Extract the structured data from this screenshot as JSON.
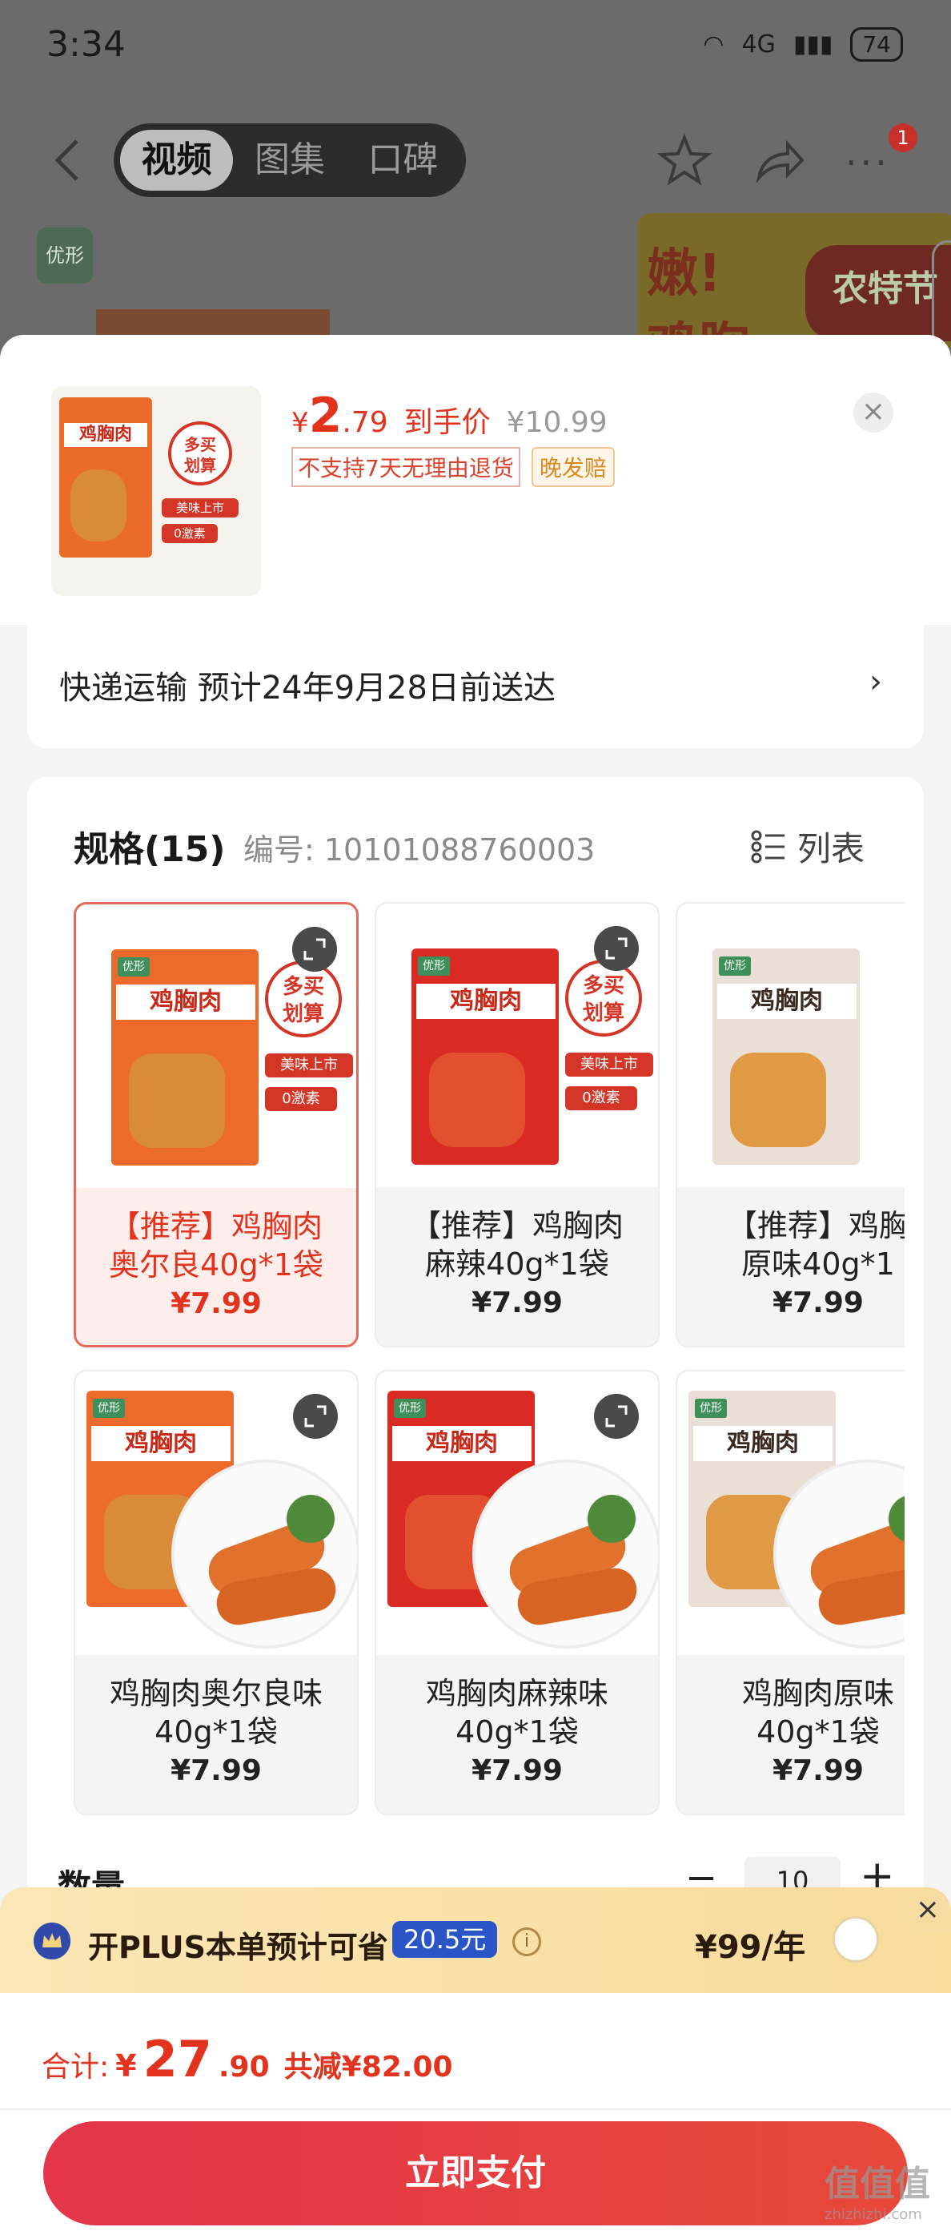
{
  "status": {
    "time": "3:34",
    "signal": "4G",
    "battery": "74"
  },
  "nav": {
    "tabs": [
      "视频",
      "图集",
      "口碑"
    ],
    "badge": "1"
  },
  "background": {
    "brand": "优形",
    "banner1": "嫩!",
    "banner1b": "鸡胸",
    "banner2": "农特节"
  },
  "sheet": {
    "price_symbol": "¥",
    "price_int": "2",
    "price_dec": ".79",
    "price_label": "到手价",
    "orig_price": "¥10.99",
    "tag_no_return": "不支持7天无理由退货",
    "tag_late": "晚发赔",
    "close": "×"
  },
  "shipping": {
    "text": "快递运输 预计24年9月28日前送达",
    "chevron": "›"
  },
  "spec": {
    "title": "规格(15)",
    "code": "编号: 10101088760003",
    "list_label": "列表"
  },
  "skus": [
    {
      "name": "【推荐】鸡胸肉\n奥尔良40g*1袋",
      "price": "¥7.99"
    },
    {
      "name": "【推荐】鸡胸肉\n麻辣40g*1袋",
      "price": "¥7.99"
    },
    {
      "name": "【推荐】鸡胸\n原味40g*1",
      "price": "¥7.99"
    },
    {
      "name": "鸡胸肉奥尔良味\n40g*1袋",
      "price": "¥7.99"
    },
    {
      "name": "鸡胸肉麻辣味\n40g*1袋",
      "price": "¥7.99"
    },
    {
      "name": "鸡胸肉原味\n40g*1袋",
      "price": "¥7.99"
    }
  ],
  "pack": {
    "brand": "优形",
    "name": "鸡胸肉",
    "badge": "多买\n划算",
    "pill1": "美味上市",
    "pill2": "0激素"
  },
  "quantity": {
    "label": "数量",
    "minus": "−",
    "value": "10",
    "plus": "+"
  },
  "plus": {
    "text": "开PLUS本单预计可省",
    "save": "20.5元",
    "price": "¥99/年",
    "close": "×"
  },
  "total": {
    "label": "合计:",
    "symbol": "¥",
    "int": "27",
    "dec": ".90",
    "discount": "共减¥82.00"
  },
  "pay": {
    "label": "立即支付"
  },
  "watermark": {
    "text": "值值值",
    "url": "zhizhizhi.com"
  },
  "colors": {
    "accent": "#e2331f",
    "plus_blue": "#2b55c7",
    "plus_bg": "#f8dc9c"
  }
}
